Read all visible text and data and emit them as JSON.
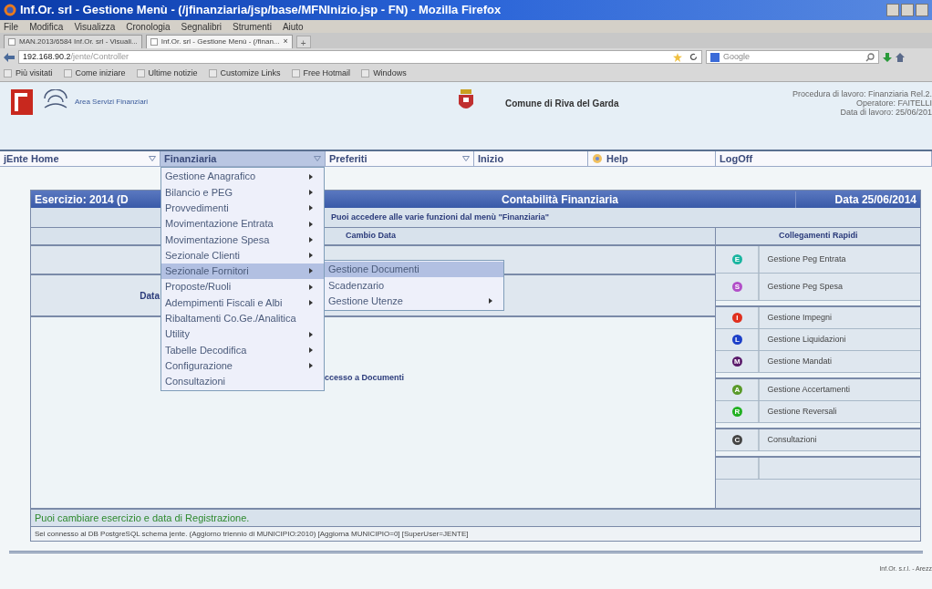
{
  "window": {
    "title": "Inf.Or. srl - Gestione Menù - (/jfinanziaria/jsp/base/MFNInizio.jsp - FN) - Mozilla Firefox"
  },
  "menubar": [
    "File",
    "Modifica",
    "Visualizza",
    "Cronologia",
    "Segnalibri",
    "Strumenti",
    "Aiuto"
  ],
  "tabs": [
    {
      "label": "MAN.2013/6584 Inf.Or. srl - Visuali...",
      "selected": false
    },
    {
      "label": "Inf.Or. srl - Gestione Menù - (/finan...",
      "selected": true
    }
  ],
  "new_tab": "+",
  "close_tab": "×",
  "address": {
    "host": "192.168.90.2",
    "path": "/jente/Controller"
  },
  "search": {
    "placeholder": "Google"
  },
  "bookmarks": [
    "Più visitati",
    "Come iniziare",
    "Ultime notizie",
    "Customize Links",
    "Free Hotmail",
    "Windows"
  ],
  "header": {
    "area": "Area Servizi Finanziari",
    "comune": "Comune di Riva del Garda",
    "info": [
      "Procedura di lavoro: Finanziaria Rel.2.",
      "Operatore: FAITELLI",
      "Data di lavoro: 25/06/201"
    ]
  },
  "nav": [
    {
      "label": "jEnte Home",
      "kind": "dropdown",
      "selected": false
    },
    {
      "label": "Finanziaria",
      "kind": "dropdown",
      "selected": true
    },
    {
      "label": "Preferiti",
      "kind": "dropdown",
      "selected": false
    },
    {
      "label": "Inizio",
      "kind": "plain",
      "selected": false
    },
    {
      "label": "Help",
      "kind": "help",
      "selected": false
    },
    {
      "label": "LogOff",
      "kind": "plain",
      "selected": false
    }
  ],
  "menu": [
    {
      "label": "Gestione Anagrafico",
      "submenu": true,
      "selected": false
    },
    {
      "label": "Bilancio e PEG",
      "submenu": true,
      "selected": false
    },
    {
      "label": "Provvedimenti",
      "submenu": true,
      "selected": false
    },
    {
      "label": "Movimentazione Entrata",
      "submenu": true,
      "selected": false
    },
    {
      "label": "Movimentazione Spesa",
      "submenu": true,
      "selected": false
    },
    {
      "label": "Sezionale Clienti",
      "submenu": true,
      "selected": false
    },
    {
      "label": "Sezionale Fornitori",
      "submenu": true,
      "selected": true
    },
    {
      "label": "Proposte/Ruoli",
      "submenu": true,
      "selected": false
    },
    {
      "label": "Adempimenti Fiscali e Albi",
      "submenu": true,
      "selected": false
    },
    {
      "label": "Ribaltamenti Co.Ge./Analitica",
      "submenu": false,
      "selected": false
    },
    {
      "label": "Utility",
      "submenu": true,
      "selected": false
    },
    {
      "label": "Tabelle Decodifica",
      "submenu": true,
      "selected": false
    },
    {
      "label": "Configurazione",
      "submenu": true,
      "selected": false
    },
    {
      "label": "Consultazioni",
      "submenu": false,
      "selected": false
    }
  ],
  "submenu": [
    {
      "label": "Gestione Documenti",
      "submenu": false,
      "selected": true
    },
    {
      "label": "Scadenzario",
      "submenu": false,
      "selected": false
    },
    {
      "label": "Gestione Utenze",
      "submenu": true,
      "selected": false
    }
  ],
  "panel": {
    "exercise": "Esercizio: 2014 (D",
    "title": "Contabilità Finanziaria",
    "date": "Data 25/06/2014",
    "intro": "Puoi accedere alle varie funzioni dal menù \"Finanziaria\"",
    "change_date": "Cambio Data",
    "date_label": "Data",
    "docs": "ccesso a Documenti",
    "quick_title": "Collegamenti Rapidi",
    "quick_links": [
      [
        {
          "letter": "E",
          "label": "Gestione Peg Entrata",
          "color": "#1ab5a0"
        },
        {
          "letter": "S",
          "label": "Gestione Peg Spesa",
          "color": "#b24fc8"
        }
      ],
      [
        {
          "letter": "I",
          "label": "Gestione Impegni",
          "color": "#e0301e"
        },
        {
          "letter": "L",
          "label": "Gestione Liquidazioni",
          "color": "#1c3fc8"
        },
        {
          "letter": "M",
          "label": "Gestione Mandati",
          "color": "#5a1a6a"
        }
      ],
      [
        {
          "letter": "A",
          "label": "Gestione Accertamenti",
          "color": "#5a9a2a"
        },
        {
          "letter": "R",
          "label": "Gestione Reversali",
          "color": "#22b022"
        }
      ],
      [
        {
          "letter": "C",
          "label": "Consultazioni",
          "color": "#444444"
        }
      ]
    ],
    "message": "Puoi cambiare esercizio e data di Registrazione.",
    "status": "Sei connesso al DB PostgreSQL schema jente. (Aggiorno triennio di MUNICIPIO:2010) [Aggiorna MUNICIPIO=0] [SuperUser=JENTE]"
  },
  "footer": "Inf.Or. s.r.l. - Arezz"
}
